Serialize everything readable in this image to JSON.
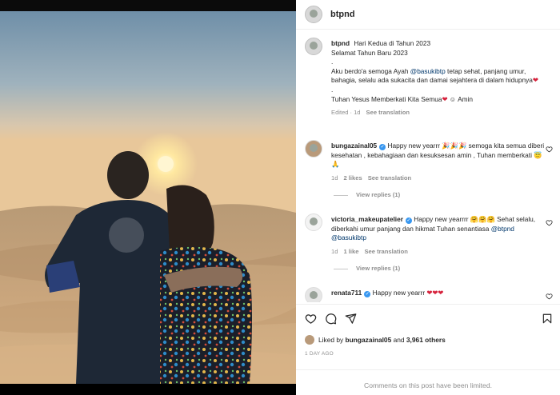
{
  "post": {
    "username": "btpnd",
    "caption_user": "btpnd",
    "caption_lines": [
      "Hari Kedua di Tahun 2023",
      "Selamat Tahun Baru 2023",
      ".",
      "Aku berdo'a semoga Ayah",
      "@basukibtp",
      "tetap sehat, panjang umur, bahagia, selalu ada sukacita dan damai sejahtera di dalam hidupnya",
      ".",
      "Tuhan Yesus Memberkati Kita Semua",
      "Amin"
    ],
    "caption_meta": {
      "edited": "Edited",
      "age": "1d",
      "translate": "See translation"
    }
  },
  "comments": [
    {
      "username": "bungazainal05",
      "text_a": "Happy new yearrr",
      "text_b": "semoga kita semua diberi kesehatan , kebahagiaan dan kesuksesan amin , Tuhan memberkati",
      "age": "1d",
      "likes": "2 likes",
      "translate": "See translation",
      "replies": "View replies (1)"
    },
    {
      "username": "victoria_makeupatelier",
      "text_a": "Happy new yearrrr",
      "text_b": "Sehat selalu, diberkahi umur panjang dan hikmat Tuhan senantiasa",
      "mention_a": "@btpnd",
      "mention_b": "@basukibtp",
      "age": "1d",
      "likes": "1 like",
      "translate": "See translation",
      "replies": "View replies (1)"
    },
    {
      "username": "renata711",
      "text_a": "Happy new yearrr"
    }
  ],
  "footer": {
    "liked_by_prefix": "Liked by",
    "liked_by_user": "bungazainal05",
    "liked_by_and": "and",
    "liked_by_count": "3,961 others",
    "date": "1 DAY AGO",
    "limited": "Comments on this post have been limited."
  },
  "icons": [
    "heart-icon",
    "comment-icon",
    "share-icon",
    "bookmark-icon"
  ]
}
